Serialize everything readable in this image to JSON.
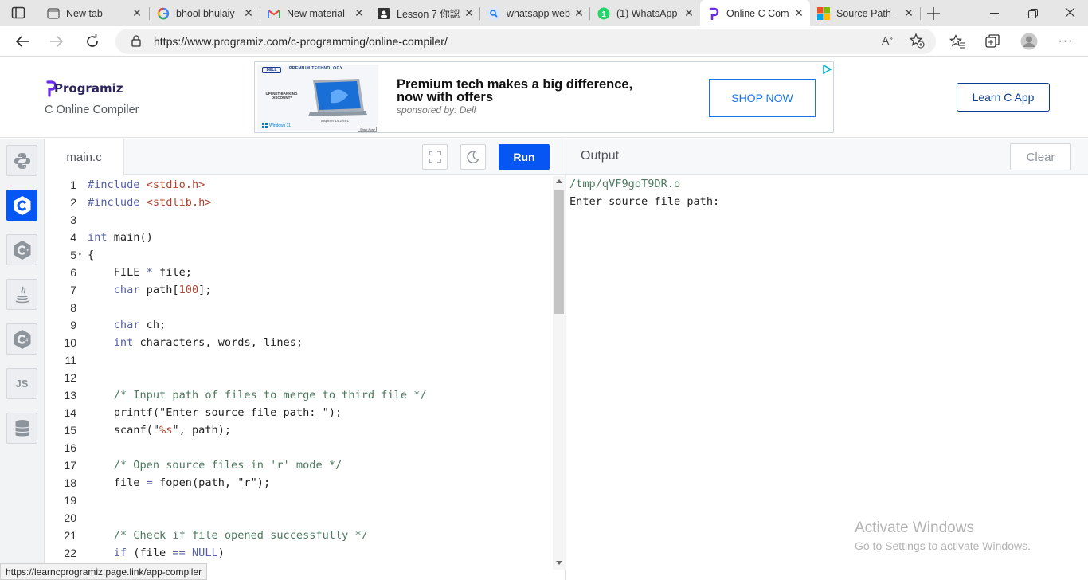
{
  "browser": {
    "tabs": [
      {
        "title": "New tab",
        "icon": "new-tab-icon"
      },
      {
        "title": "bhool bhulaiy",
        "icon": "google-icon"
      },
      {
        "title": "New material",
        "icon": "gmail-icon"
      },
      {
        "title": "Lesson 7 你認",
        "icon": "classroom-icon"
      },
      {
        "title": "whatsapp web",
        "icon": "search-icon"
      },
      {
        "title": "(1) WhatsApp",
        "icon": "whatsapp-icon"
      },
      {
        "title": "Online C Com",
        "icon": "programiz-icon"
      },
      {
        "title": "Source Path -",
        "icon": "microsoft-icon"
      }
    ],
    "url": "https://www.programiz.com/c-programming/online-compiler/",
    "status_url": "https://learncprogramiz.page.link/app-compiler"
  },
  "header": {
    "logo": "Programiz",
    "subtitle": "C Online Compiler",
    "learn_button": "Learn C App"
  },
  "ad": {
    "brand": "DELL",
    "badge": "PREMIUM TECHNOLOGY",
    "promo": "UPI/NET-BANKING DISCOUNT*",
    "product": "Inspiron 14 2-in-1",
    "os": "Windows 11",
    "shop_small": "Shop Now",
    "headline_1": "Premium tech makes a big difference,",
    "headline_2": "now with offers",
    "sponsor": "sponsored by: Dell",
    "cta": "SHOP NOW"
  },
  "editor": {
    "filename": "main.c",
    "run_label": "Run",
    "lines": [
      {
        "n": "1",
        "segs": [
          {
            "t": "#include ",
            "c": "kw"
          },
          {
            "t": "<stdio.h>",
            "c": "str"
          }
        ]
      },
      {
        "n": "2",
        "segs": [
          {
            "t": "#include ",
            "c": "kw"
          },
          {
            "t": "<stdlib.h>",
            "c": "str"
          }
        ]
      },
      {
        "n": "3",
        "segs": []
      },
      {
        "n": "4",
        "segs": [
          {
            "t": "int",
            "c": "kw"
          },
          {
            "t": " main()",
            "c": ""
          }
        ]
      },
      {
        "n": "5",
        "segs": [
          {
            "t": "{",
            "c": ""
          }
        ],
        "fold": true
      },
      {
        "n": "6",
        "segs": [
          {
            "t": "    FILE ",
            "c": ""
          },
          {
            "t": "*",
            "c": "kw"
          },
          {
            "t": " file;",
            "c": ""
          }
        ]
      },
      {
        "n": "7",
        "segs": [
          {
            "t": "    ",
            "c": ""
          },
          {
            "t": "char",
            "c": "kw"
          },
          {
            "t": " path[",
            "c": ""
          },
          {
            "t": "100",
            "c": "num"
          },
          {
            "t": "];",
            "c": ""
          }
        ]
      },
      {
        "n": "8",
        "segs": []
      },
      {
        "n": "9",
        "segs": [
          {
            "t": "    ",
            "c": ""
          },
          {
            "t": "char",
            "c": "kw"
          },
          {
            "t": " ch;",
            "c": ""
          }
        ]
      },
      {
        "n": "10",
        "segs": [
          {
            "t": "    ",
            "c": ""
          },
          {
            "t": "int",
            "c": "kw"
          },
          {
            "t": " characters, words, lines;",
            "c": ""
          }
        ]
      },
      {
        "n": "11",
        "segs": []
      },
      {
        "n": "12",
        "segs": []
      },
      {
        "n": "13",
        "segs": [
          {
            "t": "    /* Input path of files to merge to third file */",
            "c": "cm"
          }
        ]
      },
      {
        "n": "14",
        "segs": [
          {
            "t": "    printf(\"Enter source file path: \");",
            "c": ""
          }
        ]
      },
      {
        "n": "15",
        "segs": [
          {
            "t": "    scanf(\"",
            "c": ""
          },
          {
            "t": "%s",
            "c": "str"
          },
          {
            "t": "\", path);",
            "c": ""
          }
        ]
      },
      {
        "n": "16",
        "segs": []
      },
      {
        "n": "17",
        "segs": [
          {
            "t": "    /* Open source files in 'r' mode */",
            "c": "cm"
          }
        ]
      },
      {
        "n": "18",
        "segs": [
          {
            "t": "    file ",
            "c": ""
          },
          {
            "t": "=",
            "c": "kw"
          },
          {
            "t": " fopen(path, \"r\");",
            "c": ""
          }
        ]
      },
      {
        "n": "19",
        "segs": []
      },
      {
        "n": "20",
        "segs": []
      },
      {
        "n": "21",
        "segs": [
          {
            "t": "    /* Check if file opened successfully */",
            "c": "cm"
          }
        ]
      },
      {
        "n": "22",
        "segs": [
          {
            "t": "    ",
            "c": ""
          },
          {
            "t": "if",
            "c": "kw"
          },
          {
            "t": " (file ",
            "c": ""
          },
          {
            "t": "==",
            "c": "kw"
          },
          {
            "t": " ",
            "c": ""
          },
          {
            "t": "NULL",
            "c": "kw"
          },
          {
            "t": ")",
            "c": ""
          }
        ]
      }
    ]
  },
  "output": {
    "title": "Output",
    "clear_label": "Clear",
    "lines": [
      "/tmp/qVF9goT9DR.o",
      "Enter source file path:"
    ]
  },
  "sidebar": {
    "languages": [
      "python-icon",
      "c-icon",
      "cpp-icon",
      "java-icon",
      "csharp-icon",
      "js-icon",
      "sql-database-icon"
    ],
    "js_label": "JS"
  },
  "watermark": {
    "title": "Activate Windows",
    "subtitle": "Go to Settings to activate Windows."
  },
  "colors": {
    "accent": "#0556f3",
    "tabbar": "#e6e6e6",
    "sidebar": "#f2f3f5"
  }
}
